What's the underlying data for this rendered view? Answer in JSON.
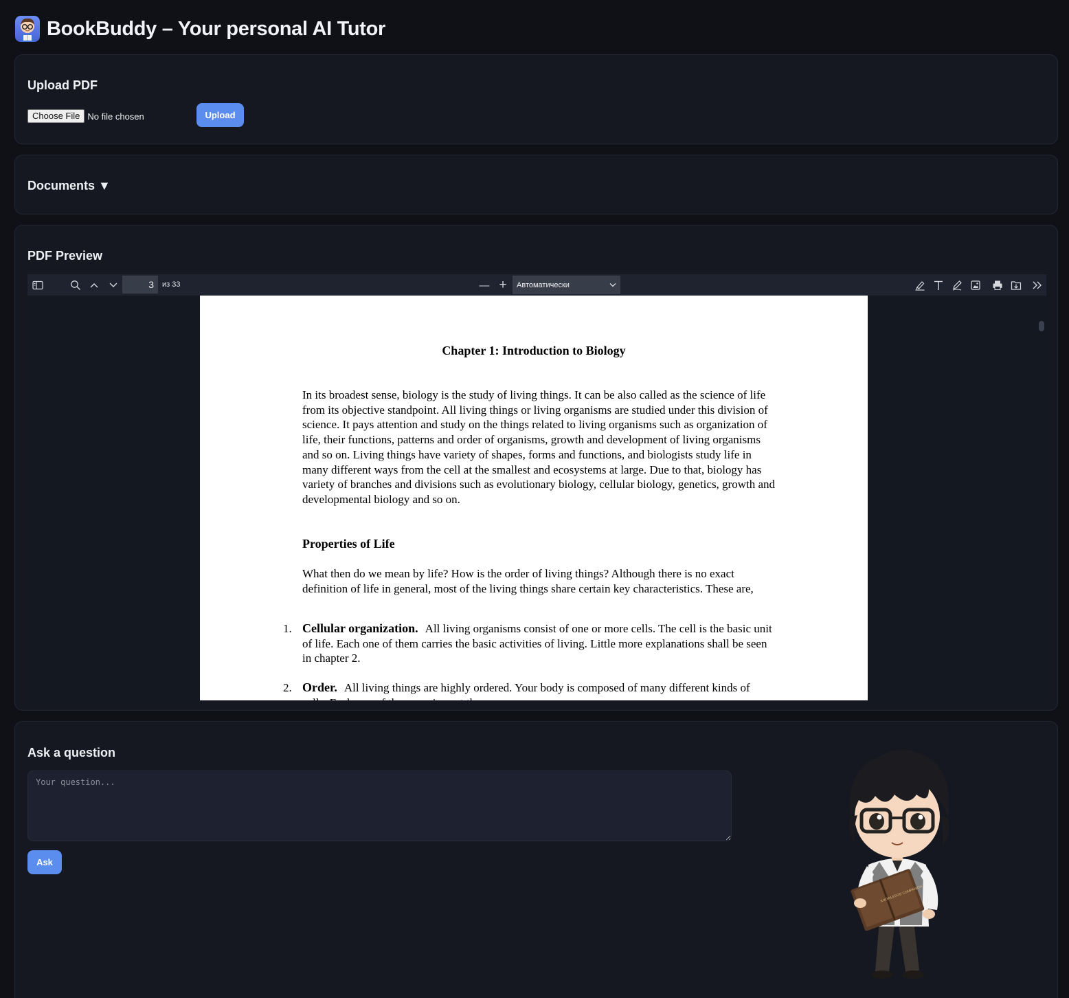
{
  "app": {
    "title": "BookBuddy – Your personal AI Tutor",
    "logo_icon": "student-reading-icon"
  },
  "upload": {
    "title": "Upload PDF",
    "choose_file_label": "Choose File",
    "file_status": "No file chosen",
    "upload_label": "Upload"
  },
  "documents": {
    "title": "Documents ▼"
  },
  "preview": {
    "title": "PDF Preview",
    "toolbar": {
      "page_number": "3",
      "page_count": "из 33",
      "zoom_option": "Автоматически",
      "minus_symbol": "—",
      "plus_symbol": "+"
    },
    "page": {
      "chapter_title": "Chapter 1: Introduction to Biology",
      "intro_paragraph": "In its broadest sense, biology is the study of living things. It can be also called as the science of life from its objective standpoint. All living things or living organisms are studied under this division of science. It pays attention and study on the things related to living organisms such as organization of life, their functions, patterns and order of organisms, growth and development of living organisms and so on. Living things have variety of shapes, forms and functions, and biologists study life in many different ways from the cell at the smallest and ecosystems at large. Due to that, biology has variety of branches and divisions such as evolutionary biology, cellular biology, genetics, growth and developmental biology and so on.",
      "section_heading": "Properties of Life",
      "section_paragraph": "What then do we mean by life? How is the order of living things? Although there is no exact definition of life in general, most of the living things share certain key characteristics. These are,",
      "items": [
        {
          "num": "1.",
          "term": "Cellular organization.",
          "text": "All living organisms consist of one or more cells. The cell is the basic unit of life. Each one of them carries the basic activities of living. Little more explanations shall be seen in chapter 2."
        },
        {
          "num": "2.",
          "term": "Order.",
          "text": "All living things are highly ordered. Your body is composed of many different kinds of cells. Each one of them carries out the...."
        }
      ]
    }
  },
  "ask": {
    "title": "Ask a question",
    "placeholder": "Your question...",
    "ask_label": "Ask",
    "book_title": "KNOWLEDGE COMPANION"
  }
}
